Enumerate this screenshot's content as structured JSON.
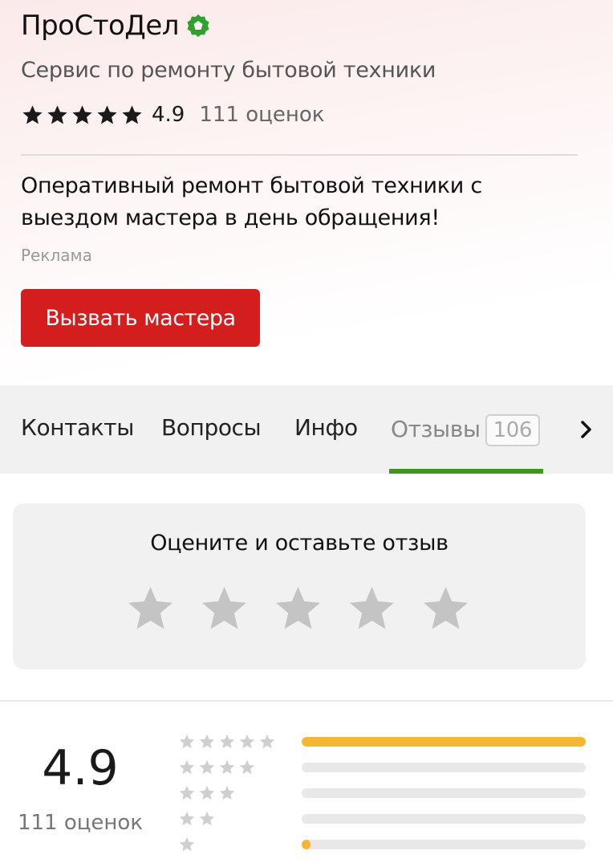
{
  "header": {
    "title": "ПроСтоДел",
    "verified_icon": "verified-badge-icon",
    "subtitle": "Сервис по ремонту бытовой техники",
    "rating_value": "4.9",
    "rating_stars": 5,
    "rating_count": "111 оценок",
    "promo_text": "Оперативный ремонт бытовой техники с выездом мастера в день обращения!",
    "ad_label": "Реклама",
    "cta_label": "Вызвать мастера"
  },
  "tabs": {
    "items": [
      {
        "label": "Контакты"
      },
      {
        "label": "Вопросы"
      },
      {
        "label": "Инфо"
      },
      {
        "label": "Отзывы",
        "badge": "106",
        "active": true
      }
    ],
    "next_icon": "chevron-right-icon"
  },
  "review_card": {
    "prompt": "Оцените и оставьте отзыв",
    "stars": 5
  },
  "summary": {
    "rating_value": "4.9",
    "rating_count": "111 оценок",
    "distribution": [
      {
        "stars": 5,
        "fraction": 1.0
      },
      {
        "stars": 4,
        "fraction": 0.0
      },
      {
        "stars": 3,
        "fraction": 0.0
      },
      {
        "stars": 2,
        "fraction": 0.0
      },
      {
        "stars": 1,
        "fraction": 0.03
      }
    ]
  },
  "colors": {
    "accent_red": "#d41d1d",
    "active_tab_green": "#3a9a1a",
    "bar_fill": "#f5b731",
    "verified_green": "#2fa12f"
  }
}
